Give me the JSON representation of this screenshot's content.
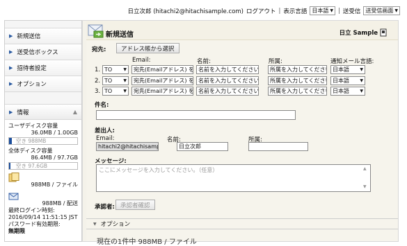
{
  "header": {
    "user": "日立次郎 (hitachi2@hitachisample.com)",
    "logout": "ログアウト",
    "display_lang_label": "表示言語",
    "display_lang_value": "日本語",
    "send_label": "送受信",
    "send_value": "送受信画面"
  },
  "sidebar": {
    "items": [
      {
        "label": "新規送信"
      },
      {
        "label": "送受信ボックス"
      },
      {
        "label": "招待者設定"
      },
      {
        "label": "オプション"
      }
    ],
    "info_label": "情報",
    "user_disk_label": "ユーザディスク容量",
    "user_disk_value": "36.0MB / 1.00GB",
    "user_disk_free": "空き 988MB",
    "user_disk_used_fraction": 0.04,
    "total_disk_label": "全体ディスク容量",
    "total_disk_value": "86.4MB / 97.7GB",
    "total_disk_free": "空き 97.6GB",
    "total_disk_used_fraction": 0.02,
    "per_file": "988MB / ファイル",
    "per_delivery": "988MB / 配送",
    "last_login_label": "最終ログイン時刻:",
    "last_login_value": "2016/09/14 11:51:15 JST",
    "pw_expiry_label": "パスワード有効期限:",
    "pw_expiry_value": "無期限"
  },
  "main": {
    "title": "新規送信",
    "brand": "日立 Sample",
    "to_label": "宛先:",
    "address_book_button": "アドレス帳から選択",
    "col_email": "Email:",
    "col_name": "名前:",
    "col_dept": "所属:",
    "col_lang": "通知メール言語:",
    "rows": [
      {
        "num": "1.",
        "type": "TO",
        "email_ph": "宛先(Emailアドレス) を",
        "name_ph": "名前を入力してください。",
        "dept_ph": "所属を入力してください。",
        "lang": "日本語"
      },
      {
        "num": "2.",
        "type": "TO",
        "email_ph": "宛先(Emailアドレス) を",
        "name_ph": "名前を入力してください。",
        "dept_ph": "所属を入力してください。",
        "lang": "日本語"
      },
      {
        "num": "3.",
        "type": "TO",
        "email_ph": "宛先(Emailアドレス) を",
        "name_ph": "名前を入力してください。",
        "dept_ph": "所属を入力してください。",
        "lang": "日本語"
      }
    ],
    "subject_label": "件名:",
    "sender_label": "差出人:",
    "sender_email_label": "Email:",
    "sender_email_value": "hitachi2@hitachisamp",
    "sender_name_label": "名前:",
    "sender_name_value": "日立次郎",
    "sender_dept_label": "所属:",
    "message_label": "メッセージ:",
    "message_ph": "ここにメッセージを入力してください。（任意）",
    "approver_label": "承認者:",
    "approver_button": "承認者確認",
    "option_label": "オプション",
    "bottom_partial": "現在の1件中 988MB / ファイル"
  }
}
